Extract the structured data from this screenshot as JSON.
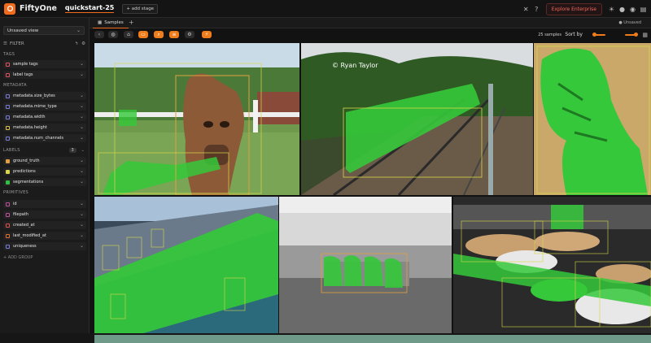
{
  "app": {
    "name": "FiftyOne",
    "dataset": "quickstart-25",
    "add_stage": "+ add stage",
    "enterprise_label": "Explore Enterprise"
  },
  "top_icons": [
    "close-icon",
    "help-icon",
    "sun-icon",
    "github-icon",
    "discord-icon",
    "docs-icon"
  ],
  "sidebar": {
    "view_select": "Unsaved view",
    "filter_label": "FILTER",
    "sections": {
      "tags": "TAGS",
      "metadata": "METADATA",
      "labels": "LABELS",
      "primitives": "PRIMITIVES"
    },
    "tags": [
      {
        "label": "sample tags",
        "color": "#e05260"
      },
      {
        "label": "label tags",
        "color": "#e05260"
      }
    ],
    "metadata": [
      {
        "label": "metadata.size_bytes",
        "color": "#7a7ad8"
      },
      {
        "label": "metadata.mime_type",
        "color": "#7a7ad8"
      },
      {
        "label": "metadata.width",
        "color": "#7a7ad8"
      },
      {
        "label": "metadata.height",
        "color": "#d8c24a"
      },
      {
        "label": "metadata.num_channels",
        "color": "#7a7ad8"
      }
    ],
    "labels_badge": "3",
    "labels": [
      {
        "label": "ground_truth",
        "color": "#e0a040",
        "checked": true
      },
      {
        "label": "predictions",
        "color": "#d8d84a",
        "checked": true
      },
      {
        "label": "segmentations",
        "color": "#30c040",
        "checked": true
      }
    ],
    "primitives": [
      {
        "label": "id",
        "color": "#c050a0"
      },
      {
        "label": "filepath",
        "color": "#c050a0"
      },
      {
        "label": "created_at",
        "color": "#e05050"
      },
      {
        "label": "last_modified_at",
        "color": "#e07030"
      },
      {
        "label": "uniqueness",
        "color": "#7a7ad8"
      }
    ],
    "add_group": "+ ADD GROUP"
  },
  "main": {
    "tab_label": "Samples",
    "unsaved_label": "Unsaved",
    "sample_count": "25 samples",
    "sort_by": "Sort by",
    "watermark": "© Ryan Taylor"
  },
  "colors": {
    "accent": "#f26b1d",
    "segmentation": "#35c83a",
    "background": "#161616"
  }
}
